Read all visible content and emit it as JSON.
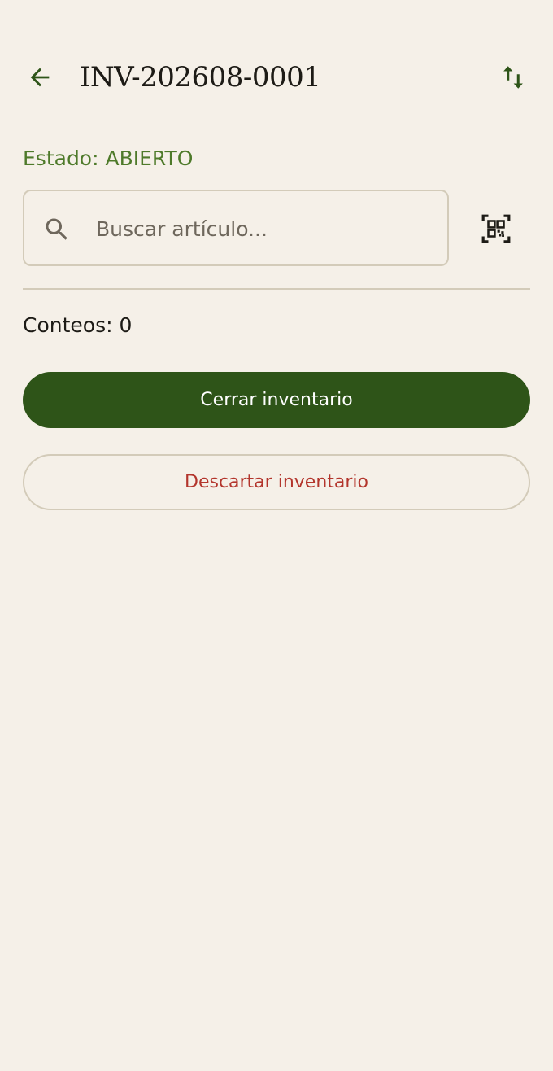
{
  "app_bar": {
    "title": "INV-202608-0001",
    "back_icon": "arrow-left-icon",
    "sort_icon": "swap-vertical-icon"
  },
  "status": {
    "text": "Estado: ABIERTO",
    "color": "#4e7a2a"
  },
  "search": {
    "placeholder": "Buscar artículo...",
    "value": "",
    "icon": "search-icon",
    "scan_icon": "qr-code-scanner-icon"
  },
  "counts": {
    "text": "Conteos: 0"
  },
  "actions": {
    "close_label": "Cerrar inventario",
    "discard_label": "Descartar inventario"
  },
  "colors": {
    "background": "#f5f0e8",
    "primary": "#2e5418",
    "danger": "#b3352c",
    "outline": "#d3cbb9"
  }
}
